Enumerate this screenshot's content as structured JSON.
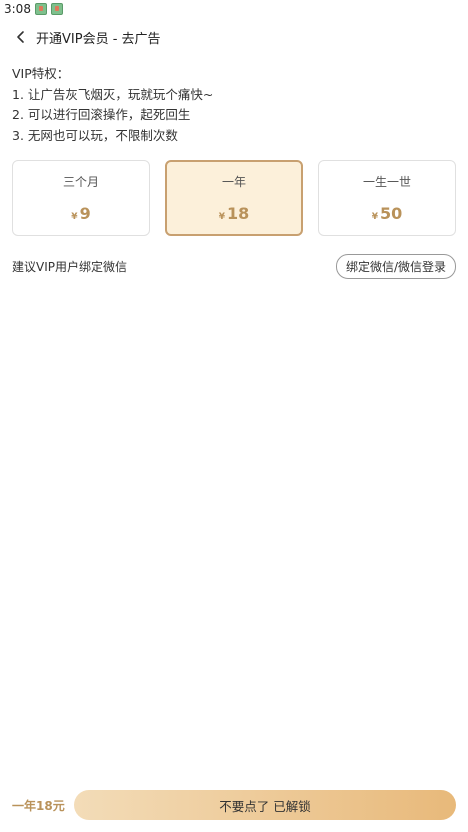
{
  "status_bar": {
    "time": "3:08"
  },
  "header": {
    "title": "开通VIP会员 - 去广告"
  },
  "perks": {
    "title": "VIP特权：",
    "items": [
      "1. 让广告灰飞烟灭，玩就玩个痛快~",
      "2. 可以进行回滚操作，起死回生",
      "3. 无网也可以玩，不限制次数"
    ]
  },
  "plans": [
    {
      "name": "三个月",
      "currency": "¥",
      "price": "9"
    },
    {
      "name": "一年",
      "currency": "¥",
      "price": "18",
      "selected": true
    },
    {
      "name": "一生一世",
      "currency": "¥",
      "price": "50"
    }
  ],
  "wechat": {
    "hint": "建议VIP用户绑定微信",
    "button_label": "绑定微信/微信登录"
  },
  "footer": {
    "summary": "一年18元",
    "unlock_label": "不要点了 已解锁"
  },
  "colors": {
    "accent": "#b9925a",
    "selected_bg": "#fcf0da",
    "selected_border": "#c8a070",
    "button_gradient_start": "#f3dcb8",
    "button_gradient_end": "#e8b97a"
  },
  "icons": {
    "back": "chevron-left-icon",
    "status": "app-notification-icon"
  }
}
